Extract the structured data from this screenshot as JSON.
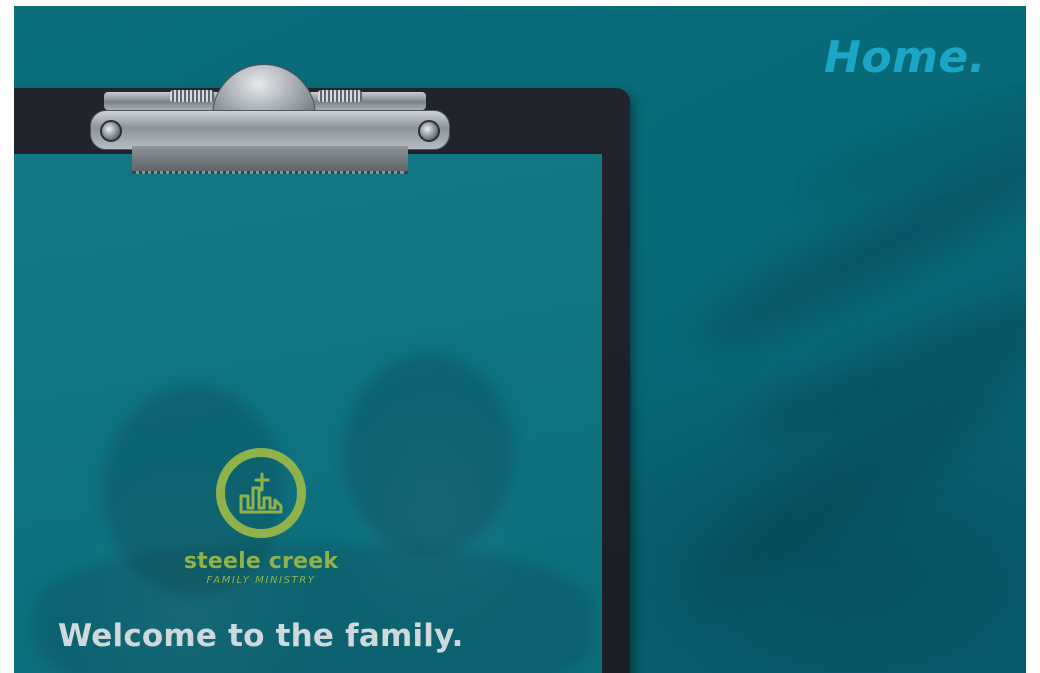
{
  "header": {
    "title": "Home."
  },
  "logo": {
    "icon": "church-town-icon",
    "name": "steele creek",
    "subtitle": "FAMILY MINISTRY"
  },
  "main": {
    "tagline": "Welcome to the family."
  },
  "colors": {
    "background": "#086977",
    "title": "#1aa7c7",
    "logo_green": "#8fb24a",
    "tagline": "#cfd9dc",
    "clipboard": "#1f2129"
  }
}
